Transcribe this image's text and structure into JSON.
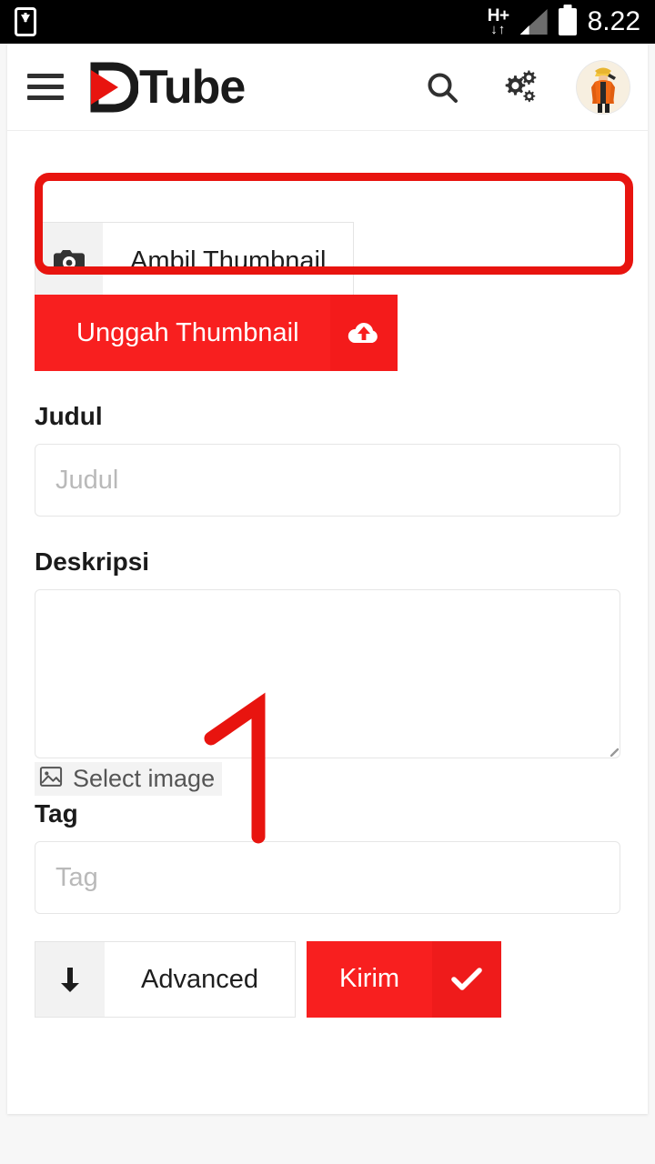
{
  "statusbar": {
    "left_icon": "phone-download-icon",
    "network_label": "H+",
    "network_arrows": "↓↑",
    "signal_icon": "signal-bars-icon",
    "battery_icon": "battery-icon",
    "time": "8.22"
  },
  "appbar": {
    "menu_icon": "hamburger-menu-icon",
    "logo_text": "Tube",
    "logo_mark": "dtube-d-play-logo",
    "search_icon": "search-icon",
    "settings_icon": "cogs-icon",
    "avatar_icon": "user-avatar"
  },
  "thumbnail": {
    "capture_label": "Ambil Thumbnail",
    "capture_icon": "camera-icon",
    "upload_label": "Unggah Thumbnail",
    "upload_icon": "cloud-upload-icon"
  },
  "form": {
    "title_label": "Judul",
    "title_placeholder": "Judul",
    "title_value": "",
    "description_label": "Deskripsi",
    "description_placeholder": "",
    "description_value": "",
    "select_image_label": "Select image",
    "select_image_icon": "image-icon",
    "tag_label": "Tag",
    "tag_placeholder": "Tag",
    "tag_value": ""
  },
  "actions": {
    "advanced_label": "Advanced",
    "advanced_icon": "arrow-down-icon",
    "submit_label": "Kirim",
    "submit_icon": "check-icon"
  },
  "annotations": {
    "step_number": "1",
    "highlight_shape": "rounded-rectangle"
  },
  "colors": {
    "brand_red": "#f81f1f",
    "annotation_red": "#e8140f",
    "submit_red": "#f81f1f",
    "submit_icon_red": "#ef1b1b",
    "text_dark": "#1b1b1b",
    "placeholder_gray": "#b9b9b9",
    "border_gray": "#e6e6e6",
    "statusbar_black": "#000000",
    "page_bg": "#f7f7f7"
  }
}
